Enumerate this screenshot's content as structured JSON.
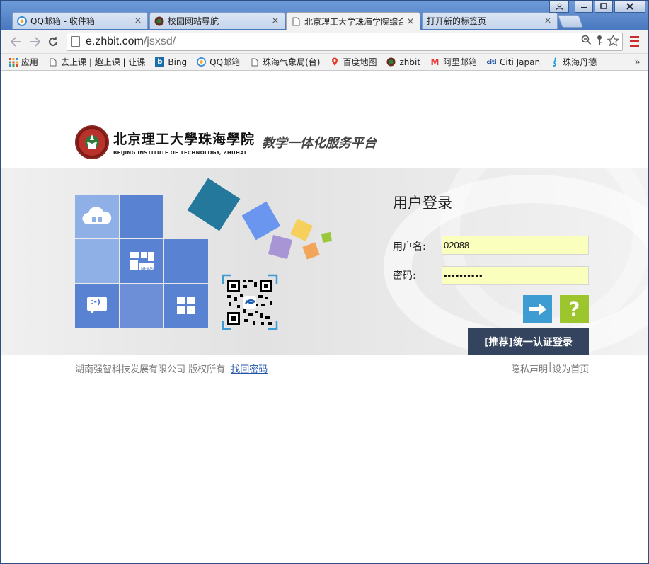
{
  "browser": {
    "tabs": [
      {
        "title": "QQ邮箱 - 收件箱",
        "icon": "qq-mail-icon",
        "active": false
      },
      {
        "title": "校园网站导航",
        "icon": "campus-nav-icon",
        "active": false
      },
      {
        "title": "北京理工大学珠海学院综合",
        "icon": "page-icon",
        "active": true
      },
      {
        "title": "打开新的标签页",
        "icon": "none",
        "active": false
      }
    ],
    "tab_close": "×",
    "address": {
      "host": "e.zhbit.com",
      "path": "/jsxsd/"
    },
    "bookmarks": [
      {
        "label": "应用",
        "icon": "apps-grid-icon",
        "color": "#e04a3a"
      },
      {
        "label": "去上课 | 趣上课 | 让课",
        "icon": "page-icon",
        "color": "#777777"
      },
      {
        "label": "Bing",
        "icon": "bing-icon",
        "color": "#1a6fa8"
      },
      {
        "label": "QQ邮箱",
        "icon": "qq-mail-icon",
        "color": "#f5a623"
      },
      {
        "label": "珠海气象局(台)",
        "icon": "page-icon",
        "color": "#777777"
      },
      {
        "label": "百度地图",
        "icon": "map-pin-icon",
        "color": "#e03b2e"
      },
      {
        "label": "zhbit",
        "icon": "zhbit-icon",
        "color": "#2d7a3a"
      },
      {
        "label": "阿里邮箱",
        "icon": "ali-mail-icon",
        "color": "#e53935"
      },
      {
        "label": "Citi Japan",
        "icon": "citi-icon",
        "color": "#1b4f9c"
      },
      {
        "label": "珠海丹德",
        "icon": "dande-icon",
        "color": "#2a9fd6"
      }
    ],
    "bookmarks_more": "»"
  },
  "page": {
    "school_name_cn": "北京理工大學珠海學院",
    "school_name_en": "BEIJING INSTITUTE OF TECHNOLOGY, ZHUHAI",
    "platform_name": "教学一体化服务平台",
    "login": {
      "title": "用户登录",
      "username_label": "用户名:",
      "username_value": "02088",
      "password_label": "密码:",
      "password_value": "••••••••••",
      "submit_glyph": "➡",
      "help_glyph": "?",
      "sso_label": "[推荐]统一认证登录"
    },
    "tiles": {
      "news_label": "NEWS",
      "chat_label": ":-)"
    },
    "footer": {
      "copyright": "湖南强智科技发展有限公司 版权所有",
      "find_password": "找回密码",
      "privacy": "隐私声明",
      "separator": "|",
      "set_home": "设为首页"
    }
  },
  "colors": {
    "tile_blue_light": "#8fb0e6",
    "tile_blue": "#5a82d2",
    "submit_blue": "#3f9cd3",
    "help_green": "#9dc52d",
    "sso_navy": "#34435e",
    "input_yellow": "#fbffbd"
  }
}
